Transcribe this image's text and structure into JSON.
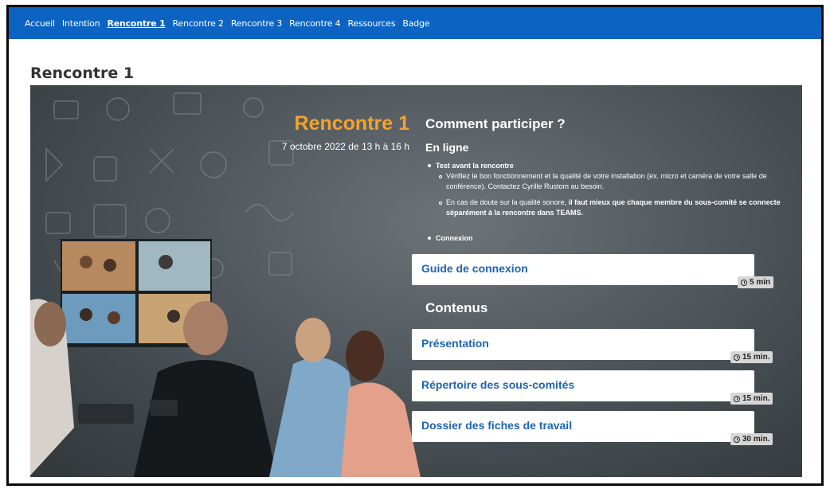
{
  "nav": {
    "items": [
      {
        "label": "Accueil",
        "active": false
      },
      {
        "label": "Intention",
        "active": false
      },
      {
        "label": "Rencontre 1",
        "active": true
      },
      {
        "label": "Rencontre 2",
        "active": false
      },
      {
        "label": "Rencontre 3",
        "active": false
      },
      {
        "label": "Rencontre 4",
        "active": false
      },
      {
        "label": "Ressources",
        "active": false
      },
      {
        "label": "Badge",
        "active": false
      }
    ]
  },
  "page": {
    "title": "Rencontre 1"
  },
  "hero": {
    "title": "Rencontre 1",
    "date": "7 octobre 2022 de 13 h à 16 h"
  },
  "participate": {
    "heading": "Comment participer ?",
    "online_heading": "En ligne",
    "test_label": "Test avant la rencontre",
    "test_item_1": "Vérifiez le bon fonctionnement et la qualité de votre installation (ex. micro et caméra de votre salle de conférence). Contactez Cyrille Rustom au besoin.",
    "test_item_2_prefix": "En cas de doute sur la qualité sonore, ",
    "test_item_2_bold": "il faut mieux que chaque membre du sous-comité se connecte séparément à la rencontre dans TEAMS.",
    "connexion_label": "Connexion",
    "guide": {
      "title": "Guide de connexion",
      "duration": "5 min"
    }
  },
  "contents": {
    "heading": "Contenus",
    "items": [
      {
        "title": "Présentation",
        "duration": "15 min."
      },
      {
        "title": "Répertoire des sous-comités",
        "duration": "15 min."
      },
      {
        "title": "Dossier des fiches de travail",
        "duration": "30 min."
      }
    ]
  },
  "colors": {
    "nav_bg": "#0d63c2",
    "accent_orange": "#f4a22d",
    "link_blue": "#1c64b3"
  }
}
